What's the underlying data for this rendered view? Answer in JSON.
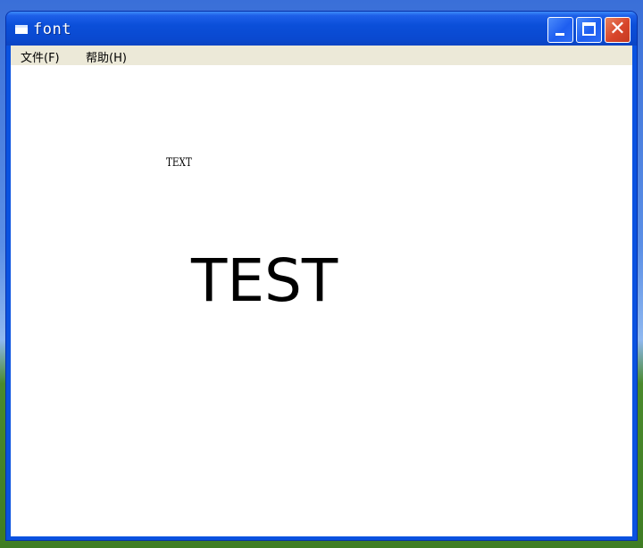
{
  "window": {
    "title": "font",
    "controls": {
      "minimize_icon": "minimize-icon",
      "maximize_icon": "maximize-icon",
      "close_icon": "close-icon",
      "close_glyph": "✕"
    },
    "accent_color": "#0a52e0"
  },
  "menubar": {
    "items": [
      {
        "label": "文件(F)"
      },
      {
        "label": "帮助(H)"
      }
    ]
  },
  "canvas": {
    "small_text": "TEXT",
    "large_text": "TEST"
  }
}
